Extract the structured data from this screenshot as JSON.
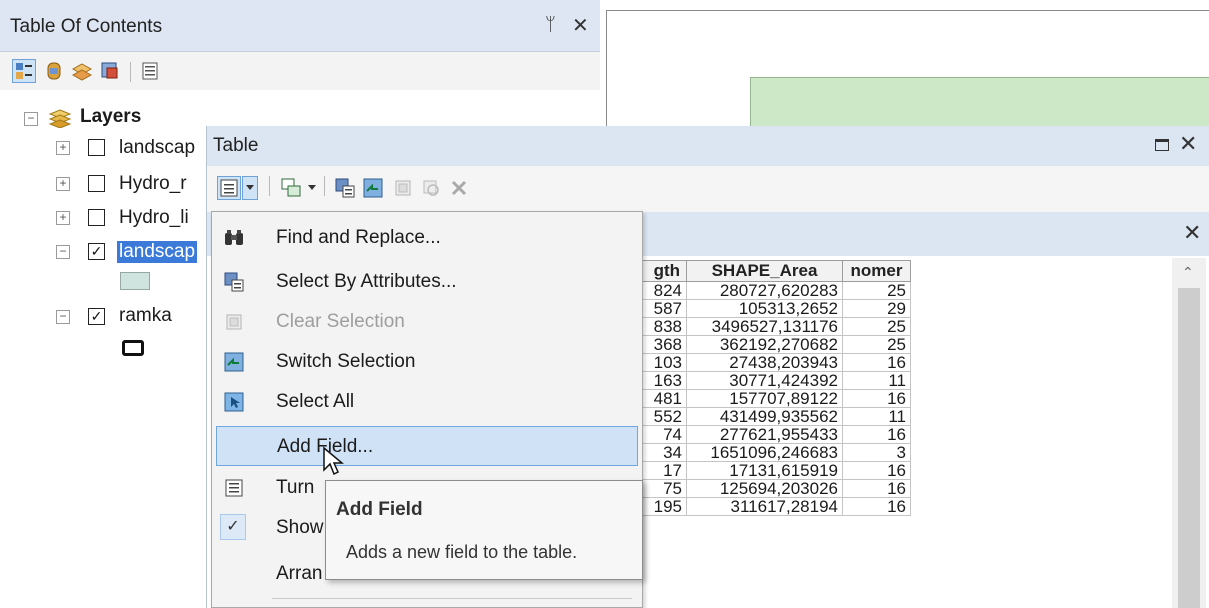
{
  "toc": {
    "title": "Table Of Contents",
    "pin_glyph": "ᛘ",
    "close_glyph": "✕",
    "toolbar_icons": [
      "list-by-drawing-order-icon",
      "list-by-source-icon",
      "list-by-visibility-icon",
      "list-by-selection-icon",
      "options-icon"
    ],
    "tree": {
      "root_label": "Layers",
      "layers": [
        {
          "label": "landscap",
          "checked": false,
          "expanded": false
        },
        {
          "label": "Hydro_r",
          "checked": false,
          "expanded": false
        },
        {
          "label": "Hydro_li",
          "checked": false,
          "expanded": false
        },
        {
          "label": "landscap",
          "checked": true,
          "expanded": true,
          "selected": true
        },
        {
          "label": "ramka",
          "checked": true,
          "expanded": true
        }
      ]
    }
  },
  "table_window": {
    "title": "Table",
    "close_glyph": "✕",
    "toolbar_icons": [
      "table-options-icon",
      "related-tables-icon",
      "select-by-attributes-icon",
      "switch-selection-icon",
      "clear-selection-icon",
      "zoom-to-selected-icon",
      "delete-selected-icon"
    ],
    "columns": [
      "gth",
      "SHAPE_Area",
      "nomer"
    ],
    "rows": [
      [
        "824",
        "280727,620283",
        "25"
      ],
      [
        "587",
        "105313,2652",
        "29"
      ],
      [
        "838",
        "3496527,131176",
        "25"
      ],
      [
        "368",
        "362192,270682",
        "25"
      ],
      [
        "103",
        "27438,203943",
        "16"
      ],
      [
        "163",
        "30771,424392",
        "11"
      ],
      [
        "481",
        "157707,89122",
        "16"
      ],
      [
        "552",
        "431499,935562",
        "11"
      ],
      [
        "74",
        "277621,955433",
        "16"
      ],
      [
        "34",
        "1651096,246683",
        "3"
      ],
      [
        "17",
        "17131,615919",
        "16"
      ],
      [
        "75",
        "125694,203026",
        "16"
      ],
      [
        "195",
        "311617,28194",
        "16"
      ]
    ]
  },
  "menu": {
    "items": [
      {
        "label": "Find and Replace...",
        "icon": "binoculars-icon",
        "disabled": false
      },
      {
        "label": "Select By Attributes...",
        "icon": "select-by-attributes-icon",
        "disabled": false
      },
      {
        "label": "Clear Selection",
        "icon": "clear-selection-icon",
        "disabled": true
      },
      {
        "label": "Switch Selection",
        "icon": "switch-selection-icon",
        "disabled": false
      },
      {
        "label": "Select All",
        "icon": "select-all-icon",
        "disabled": false
      },
      {
        "label": "Add Field...",
        "icon": "",
        "disabled": false,
        "highlighted": true
      },
      {
        "label": "Turn",
        "icon": "turn-fields-icon",
        "disabled": false
      },
      {
        "label": "Show",
        "icon": "check-icon",
        "disabled": false,
        "checked": true
      },
      {
        "label": "Arran",
        "icon": "",
        "disabled": false
      }
    ]
  },
  "tooltip": {
    "title": "Add Field",
    "description": "Adds a new field to the table."
  },
  "colors": {
    "title_bar": "#dce6f3",
    "selection_blue": "#3b7ad8",
    "menu_highlight": "#cfe2f6",
    "map_polygon": "#cde8c6"
  }
}
